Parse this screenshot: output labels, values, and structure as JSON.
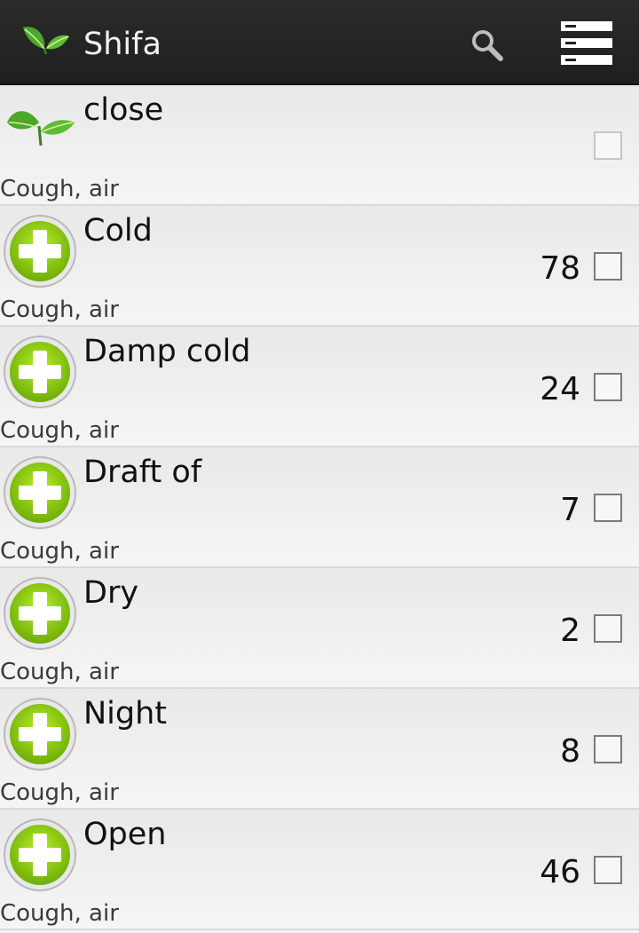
{
  "actionbar": {
    "title": "Shifa",
    "logo_icon": "leaf-logo-icon",
    "search_icon": "search-icon",
    "menu_icon": "list-menu-icon"
  },
  "rows": [
    {
      "title": "close",
      "subtitle": "Cough, air",
      "count": "",
      "icon": "leaf-icon",
      "check_enabled": false,
      "checked": false
    },
    {
      "title": "Cold",
      "subtitle": "Cough, air",
      "count": "78",
      "icon": "green-plus-icon",
      "check_enabled": true,
      "checked": false
    },
    {
      "title": "Damp cold",
      "subtitle": "Cough, air",
      "count": "24",
      "icon": "green-plus-icon",
      "check_enabled": true,
      "checked": false
    },
    {
      "title": "Draft of",
      "subtitle": "Cough, air",
      "count": "7",
      "icon": "green-plus-icon",
      "check_enabled": true,
      "checked": false
    },
    {
      "title": "Dry",
      "subtitle": "Cough, air",
      "count": "2",
      "icon": "green-plus-icon",
      "check_enabled": true,
      "checked": false
    },
    {
      "title": "Night",
      "subtitle": "Cough, air",
      "count": "8",
      "icon": "green-plus-icon",
      "check_enabled": true,
      "checked": false
    },
    {
      "title": "Open",
      "subtitle": "Cough, air",
      "count": "46",
      "icon": "green-plus-icon",
      "check_enabled": true,
      "checked": false
    }
  ],
  "colors": {
    "actionbar_bg": "#222222",
    "accent_green": "#8ccc12",
    "row_bg": "#f2f2f2"
  }
}
